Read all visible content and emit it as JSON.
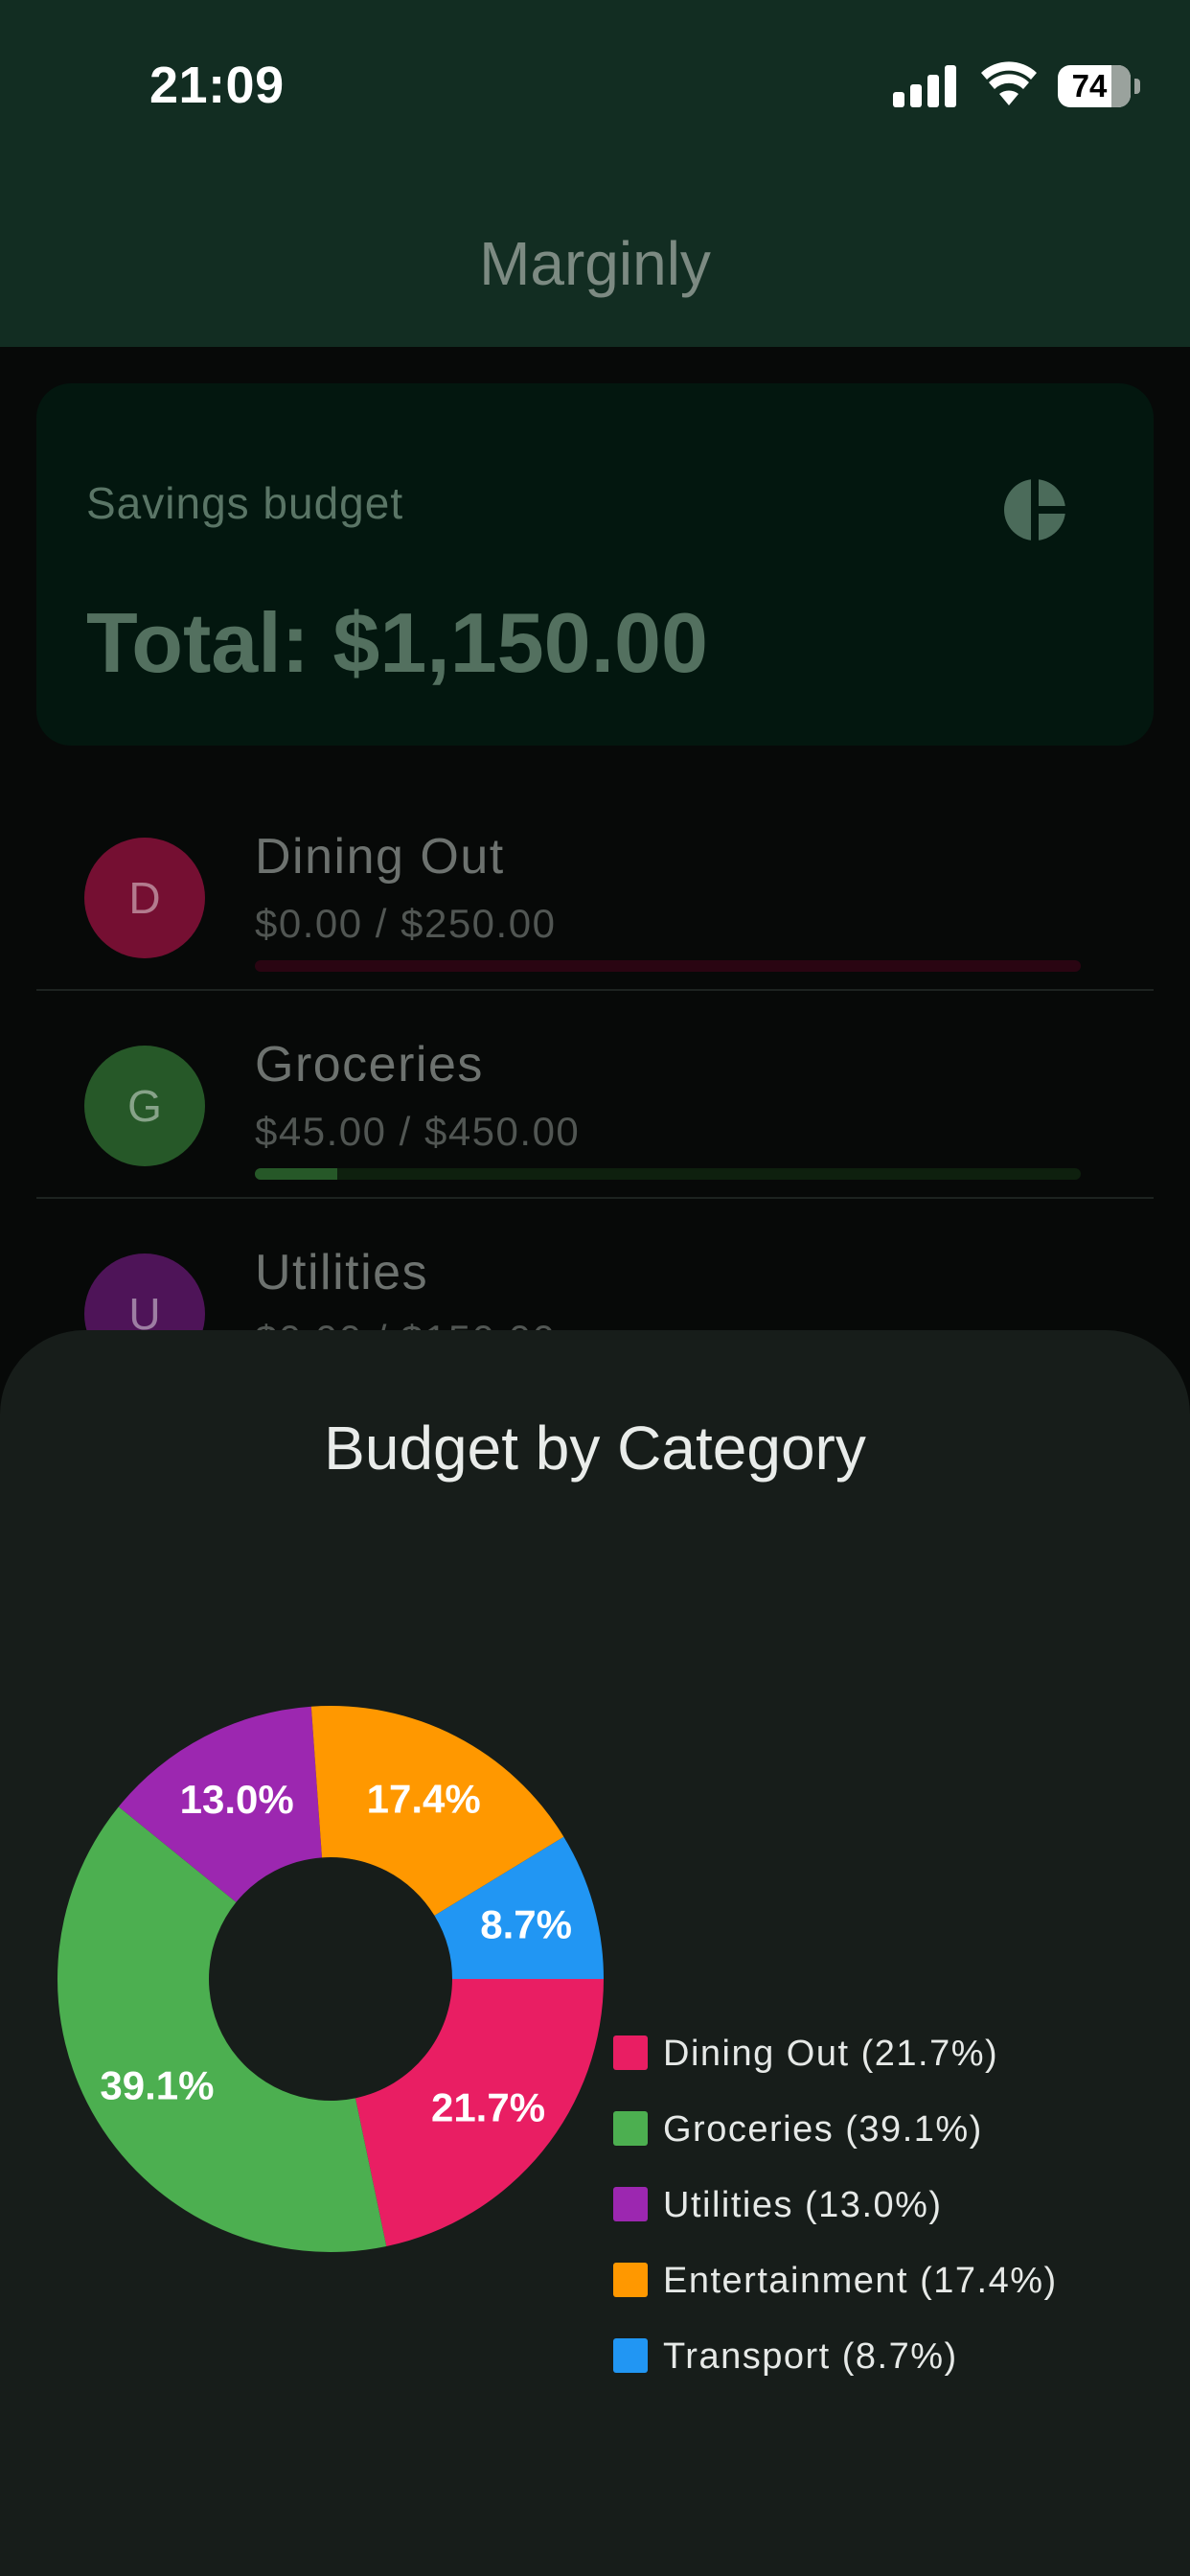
{
  "status_bar": {
    "time": "21:09",
    "battery": "74"
  },
  "app": {
    "title": "Marginly"
  },
  "budget_card": {
    "label": "Savings budget",
    "total": "Total: $1,150.00",
    "icon": "pie-chart-icon"
  },
  "categories": [
    {
      "initial": "D",
      "name": "Dining Out",
      "amount": "$0.00 / $250.00",
      "progress": 0.0,
      "color": "#e91e63"
    },
    {
      "initial": "G",
      "name": "Groceries",
      "amount": "$45.00 / $450.00",
      "progress": 0.1,
      "color": "#4caf50"
    },
    {
      "initial": "U",
      "name": "Utilities",
      "amount": "$0.00 / $150.00",
      "progress": 0.0,
      "color": "#9c27b0"
    }
  ],
  "sheet": {
    "title": "Budget by Category"
  },
  "chart_data": {
    "type": "pie",
    "style": "donut",
    "title": "Budget by Category",
    "slices": [
      {
        "category": "Dining Out",
        "value": 21.7,
        "label": "21.7%",
        "color": "#e91e63"
      },
      {
        "category": "Groceries",
        "value": 39.1,
        "label": "39.1%",
        "color": "#4caf50"
      },
      {
        "category": "Utilities",
        "value": 13.0,
        "label": "13.0%",
        "color": "#9c27b0"
      },
      {
        "category": "Entertainment",
        "value": 17.4,
        "label": "17.4%",
        "color": "#ff9800"
      },
      {
        "category": "Transport",
        "value": 8.7,
        "label": "8.7%",
        "color": "#2196f3"
      }
    ],
    "legend": [
      "Dining Out (21.7%)",
      "Groceries (39.1%)",
      "Utilities (13.0%)",
      "Entertainment (17.4%)",
      "Transport (8.7%)"
    ],
    "legend_position": "right"
  }
}
